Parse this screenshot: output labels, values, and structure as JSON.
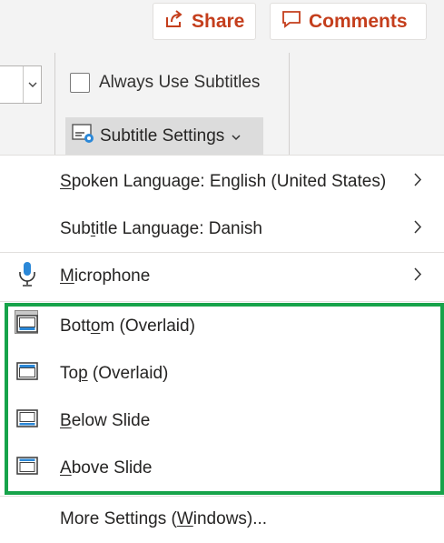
{
  "ribbon": {
    "share_label": "Share",
    "comments_label": "Comments",
    "always_use_subtitles_label": "Always Use Subtitles",
    "always_use_subtitles_checked": false,
    "subtitle_settings_label": "Subtitle Settings",
    "accent_color": "#c43e1c"
  },
  "menu": {
    "spoken_language": {
      "prefix": "",
      "ul": "S",
      "rest": "poken Language: English (United States)"
    },
    "subtitle_language": {
      "prefix": "Sub",
      "ul": "t",
      "rest": "itle Language: Danish"
    },
    "microphone": {
      "prefix": "",
      "ul": "M",
      "rest": "icrophone"
    },
    "bottom_overlaid": {
      "prefix": "Bott",
      "ul": "o",
      "rest": "m (Overlaid)"
    },
    "top_overlaid": {
      "prefix": "To",
      "ul": "p",
      "rest": " (Overlaid)"
    },
    "below_slide": {
      "prefix": "",
      "ul": "B",
      "rest": "elow Slide"
    },
    "above_slide": {
      "prefix": "",
      "ul": "A",
      "rest": "bove Slide"
    },
    "more_settings": {
      "prefix": "More Settings (",
      "ul": "W",
      "rest": "indows)..."
    },
    "selected_position": "bottom_overlaid",
    "highlight_color": "#16a34a"
  }
}
